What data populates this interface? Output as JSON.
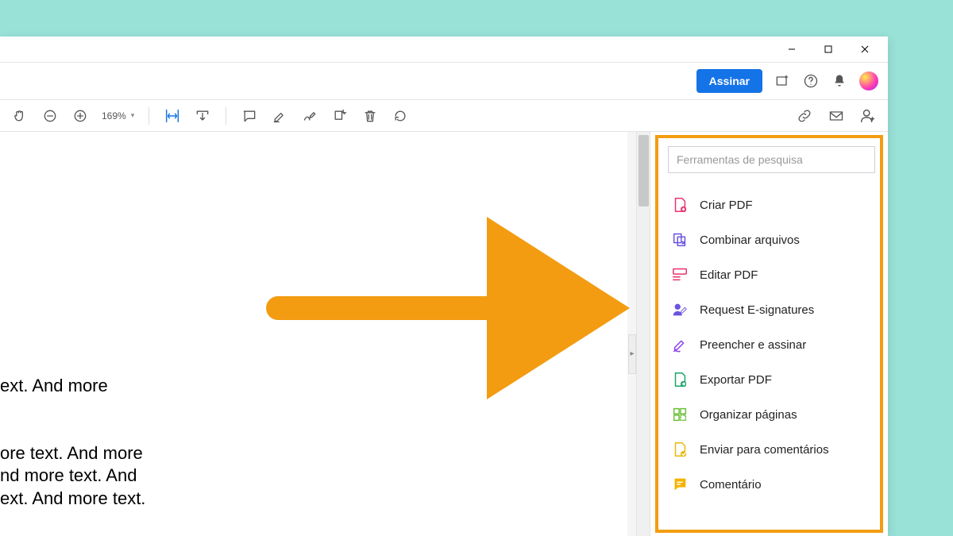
{
  "topbar": {
    "sign_label": "Assinar"
  },
  "toolbar": {
    "zoom_value": "169%"
  },
  "document": {
    "line1": "ext. And more",
    "line2": "",
    "line3": "ore text. And more",
    "line4": "nd more text. And",
    "line5": "ext. And more text."
  },
  "tools": {
    "search_placeholder": "Ferramentas de pesquisa",
    "items": [
      {
        "label": "Criar PDF",
        "color": "#e8336d",
        "icon": "create-pdf"
      },
      {
        "label": "Combinar arquivos",
        "color": "#6a53e0",
        "icon": "combine"
      },
      {
        "label": "Editar PDF",
        "color": "#e8336d",
        "icon": "edit-pdf"
      },
      {
        "label": "Request E-signatures",
        "color": "#6a53e0",
        "icon": "request-sign"
      },
      {
        "label": "Preencher e assinar",
        "color": "#8a3ff0",
        "icon": "fill-sign"
      },
      {
        "label": "Exportar PDF",
        "color": "#1aa566",
        "icon": "export-pdf"
      },
      {
        "label": "Organizar páginas",
        "color": "#6bbf3a",
        "icon": "organize"
      },
      {
        "label": "Enviar para comentários",
        "color": "#e8b80b",
        "icon": "send-comments"
      },
      {
        "label": "Comentário",
        "color": "#f5b301",
        "icon": "comment"
      }
    ]
  }
}
